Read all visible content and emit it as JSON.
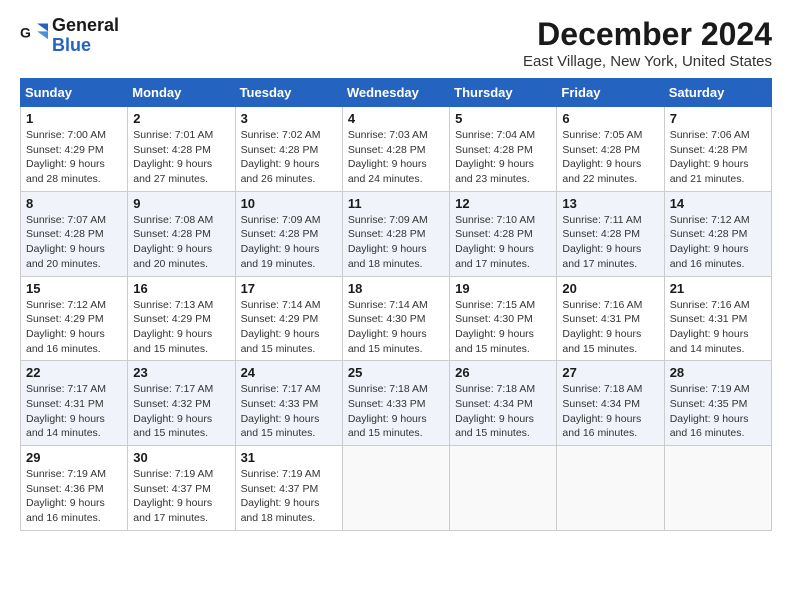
{
  "logo": {
    "line1": "General",
    "line2": "Blue"
  },
  "title": "December 2024",
  "subtitle": "East Village, New York, United States",
  "header_color": "#2563c0",
  "days_of_week": [
    "Sunday",
    "Monday",
    "Tuesday",
    "Wednesday",
    "Thursday",
    "Friday",
    "Saturday"
  ],
  "weeks": [
    [
      {
        "day": "1",
        "sunrise": "7:00 AM",
        "sunset": "4:29 PM",
        "daylight": "9 hours and 28 minutes."
      },
      {
        "day": "2",
        "sunrise": "7:01 AM",
        "sunset": "4:28 PM",
        "daylight": "9 hours and 27 minutes."
      },
      {
        "day": "3",
        "sunrise": "7:02 AM",
        "sunset": "4:28 PM",
        "daylight": "9 hours and 26 minutes."
      },
      {
        "day": "4",
        "sunrise": "7:03 AM",
        "sunset": "4:28 PM",
        "daylight": "9 hours and 24 minutes."
      },
      {
        "day": "5",
        "sunrise": "7:04 AM",
        "sunset": "4:28 PM",
        "daylight": "9 hours and 23 minutes."
      },
      {
        "day": "6",
        "sunrise": "7:05 AM",
        "sunset": "4:28 PM",
        "daylight": "9 hours and 22 minutes."
      },
      {
        "day": "7",
        "sunrise": "7:06 AM",
        "sunset": "4:28 PM",
        "daylight": "9 hours and 21 minutes."
      }
    ],
    [
      {
        "day": "8",
        "sunrise": "7:07 AM",
        "sunset": "4:28 PM",
        "daylight": "9 hours and 20 minutes."
      },
      {
        "day": "9",
        "sunrise": "7:08 AM",
        "sunset": "4:28 PM",
        "daylight": "9 hours and 20 minutes."
      },
      {
        "day": "10",
        "sunrise": "7:09 AM",
        "sunset": "4:28 PM",
        "daylight": "9 hours and 19 minutes."
      },
      {
        "day": "11",
        "sunrise": "7:09 AM",
        "sunset": "4:28 PM",
        "daylight": "9 hours and 18 minutes."
      },
      {
        "day": "12",
        "sunrise": "7:10 AM",
        "sunset": "4:28 PM",
        "daylight": "9 hours and 17 minutes."
      },
      {
        "day": "13",
        "sunrise": "7:11 AM",
        "sunset": "4:28 PM",
        "daylight": "9 hours and 17 minutes."
      },
      {
        "day": "14",
        "sunrise": "7:12 AM",
        "sunset": "4:28 PM",
        "daylight": "9 hours and 16 minutes."
      }
    ],
    [
      {
        "day": "15",
        "sunrise": "7:12 AM",
        "sunset": "4:29 PM",
        "daylight": "9 hours and 16 minutes."
      },
      {
        "day": "16",
        "sunrise": "7:13 AM",
        "sunset": "4:29 PM",
        "daylight": "9 hours and 15 minutes."
      },
      {
        "day": "17",
        "sunrise": "7:14 AM",
        "sunset": "4:29 PM",
        "daylight": "9 hours and 15 minutes."
      },
      {
        "day": "18",
        "sunrise": "7:14 AM",
        "sunset": "4:30 PM",
        "daylight": "9 hours and 15 minutes."
      },
      {
        "day": "19",
        "sunrise": "7:15 AM",
        "sunset": "4:30 PM",
        "daylight": "9 hours and 15 minutes."
      },
      {
        "day": "20",
        "sunrise": "7:16 AM",
        "sunset": "4:31 PM",
        "daylight": "9 hours and 15 minutes."
      },
      {
        "day": "21",
        "sunrise": "7:16 AM",
        "sunset": "4:31 PM",
        "daylight": "9 hours and 14 minutes."
      }
    ],
    [
      {
        "day": "22",
        "sunrise": "7:17 AM",
        "sunset": "4:31 PM",
        "daylight": "9 hours and 14 minutes."
      },
      {
        "day": "23",
        "sunrise": "7:17 AM",
        "sunset": "4:32 PM",
        "daylight": "9 hours and 15 minutes."
      },
      {
        "day": "24",
        "sunrise": "7:17 AM",
        "sunset": "4:33 PM",
        "daylight": "9 hours and 15 minutes."
      },
      {
        "day": "25",
        "sunrise": "7:18 AM",
        "sunset": "4:33 PM",
        "daylight": "9 hours and 15 minutes."
      },
      {
        "day": "26",
        "sunrise": "7:18 AM",
        "sunset": "4:34 PM",
        "daylight": "9 hours and 15 minutes."
      },
      {
        "day": "27",
        "sunrise": "7:18 AM",
        "sunset": "4:34 PM",
        "daylight": "9 hours and 16 minutes."
      },
      {
        "day": "28",
        "sunrise": "7:19 AM",
        "sunset": "4:35 PM",
        "daylight": "9 hours and 16 minutes."
      }
    ],
    [
      {
        "day": "29",
        "sunrise": "7:19 AM",
        "sunset": "4:36 PM",
        "daylight": "9 hours and 16 minutes."
      },
      {
        "day": "30",
        "sunrise": "7:19 AM",
        "sunset": "4:37 PM",
        "daylight": "9 hours and 17 minutes."
      },
      {
        "day": "31",
        "sunrise": "7:19 AM",
        "sunset": "4:37 PM",
        "daylight": "9 hours and 18 minutes."
      },
      null,
      null,
      null,
      null
    ]
  ],
  "labels": {
    "sunrise": "Sunrise:",
    "sunset": "Sunset:",
    "daylight": "Daylight:"
  }
}
